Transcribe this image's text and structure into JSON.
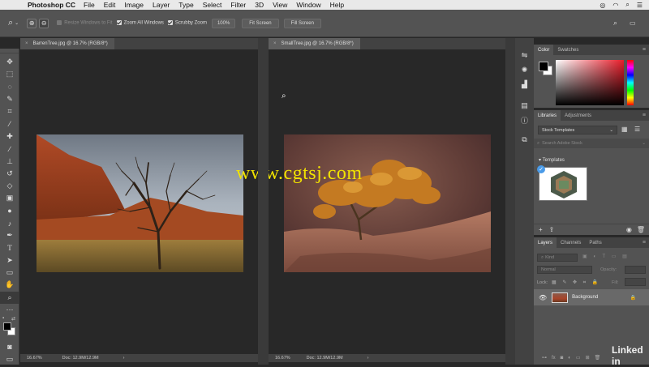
{
  "menubar": {
    "app": "Photoshop CC",
    "items": [
      "File",
      "Edit",
      "Image",
      "Layer",
      "Type",
      "Select",
      "Filter",
      "3D",
      "View",
      "Window",
      "Help"
    ]
  },
  "options": {
    "resize_label": "Resize Windows to Fit",
    "zoom_all_label": "Zoom All Windows",
    "scrubby_label": "Scrubby Zoom",
    "zoom_value": "100%",
    "fit_screen": "Fit Screen",
    "fill_screen": "Fill Screen"
  },
  "documents": [
    {
      "tab": "BarrenTree.jpg @ 16.7% (RGB/8*)",
      "zoom": "16.67%",
      "doc": "Doc: 12.9M/12.9M"
    },
    {
      "tab": "SmallTree.jpg @ 16.7% (RGB/8*)",
      "zoom": "16.67%",
      "doc": "Doc: 12.9M/12.9M"
    }
  ],
  "color_panel": {
    "tabs": [
      "Color",
      "Swatches"
    ],
    "accent": "#e81d2a"
  },
  "libraries_panel": {
    "tabs": [
      "Libraries",
      "Adjustments"
    ],
    "library_select": "Stock Templates",
    "search_placeholder": "Search Adobe Stock",
    "section": "Templates"
  },
  "layers_panel": {
    "tabs": [
      "Layers",
      "Channels",
      "Paths"
    ],
    "kind_label": "Kind",
    "blend_mode": "Normal",
    "opacity_label": "Opacity:",
    "lock_label": "Lock:",
    "fill_label": "Fill:",
    "layer_name": "Background"
  },
  "watermark": "www.cgtsj.com",
  "brand": "Linked in"
}
